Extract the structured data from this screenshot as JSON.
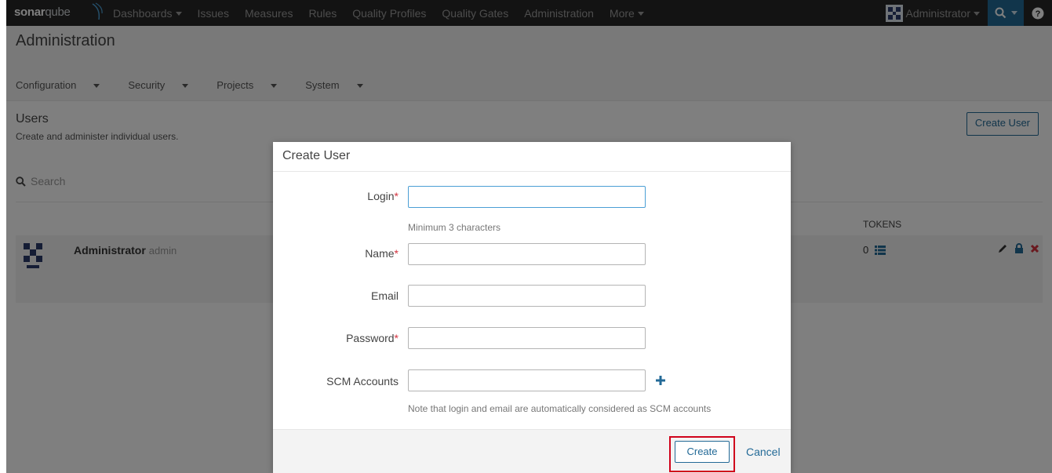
{
  "navbar": {
    "logo_bold": "sonar",
    "logo_light": "qube",
    "items": [
      {
        "label": "Dashboards",
        "dropdown": true
      },
      {
        "label": "Issues",
        "dropdown": false
      },
      {
        "label": "Measures",
        "dropdown": false
      },
      {
        "label": "Rules",
        "dropdown": false
      },
      {
        "label": "Quality Profiles",
        "dropdown": false
      },
      {
        "label": "Quality Gates",
        "dropdown": false
      },
      {
        "label": "Administration",
        "dropdown": false
      },
      {
        "label": "More",
        "dropdown": true
      }
    ],
    "user_label": "Administrator",
    "icons": [
      "search-icon",
      "help-icon"
    ],
    "accent_color": "#236a97"
  },
  "page": {
    "title": "Administration",
    "subnav": [
      "Configuration",
      "Security",
      "Projects",
      "System"
    ]
  },
  "users": {
    "title": "Users",
    "description": "Create and administer individual users.",
    "create_button": "Create User",
    "search_placeholder": "Search",
    "tokens_header": "TOKENS",
    "rows": [
      {
        "name": "Administrator",
        "login": "admin",
        "tokens": "0"
      }
    ]
  },
  "modal": {
    "title": "Create User",
    "fields": {
      "login": {
        "label": "Login",
        "required": true,
        "value": "",
        "hint": "Minimum 3 characters"
      },
      "name": {
        "label": "Name",
        "required": true,
        "value": ""
      },
      "email": {
        "label": "Email",
        "required": false,
        "value": ""
      },
      "password": {
        "label": "Password",
        "required": true,
        "value": ""
      },
      "scm": {
        "label": "SCM Accounts",
        "required": false,
        "value": "",
        "hint": "Note that login and email are automatically considered as SCM accounts"
      }
    },
    "required_mark": "*",
    "create_button": "Create",
    "cancel_link": "Cancel",
    "highlight_color": "#d0021b"
  }
}
